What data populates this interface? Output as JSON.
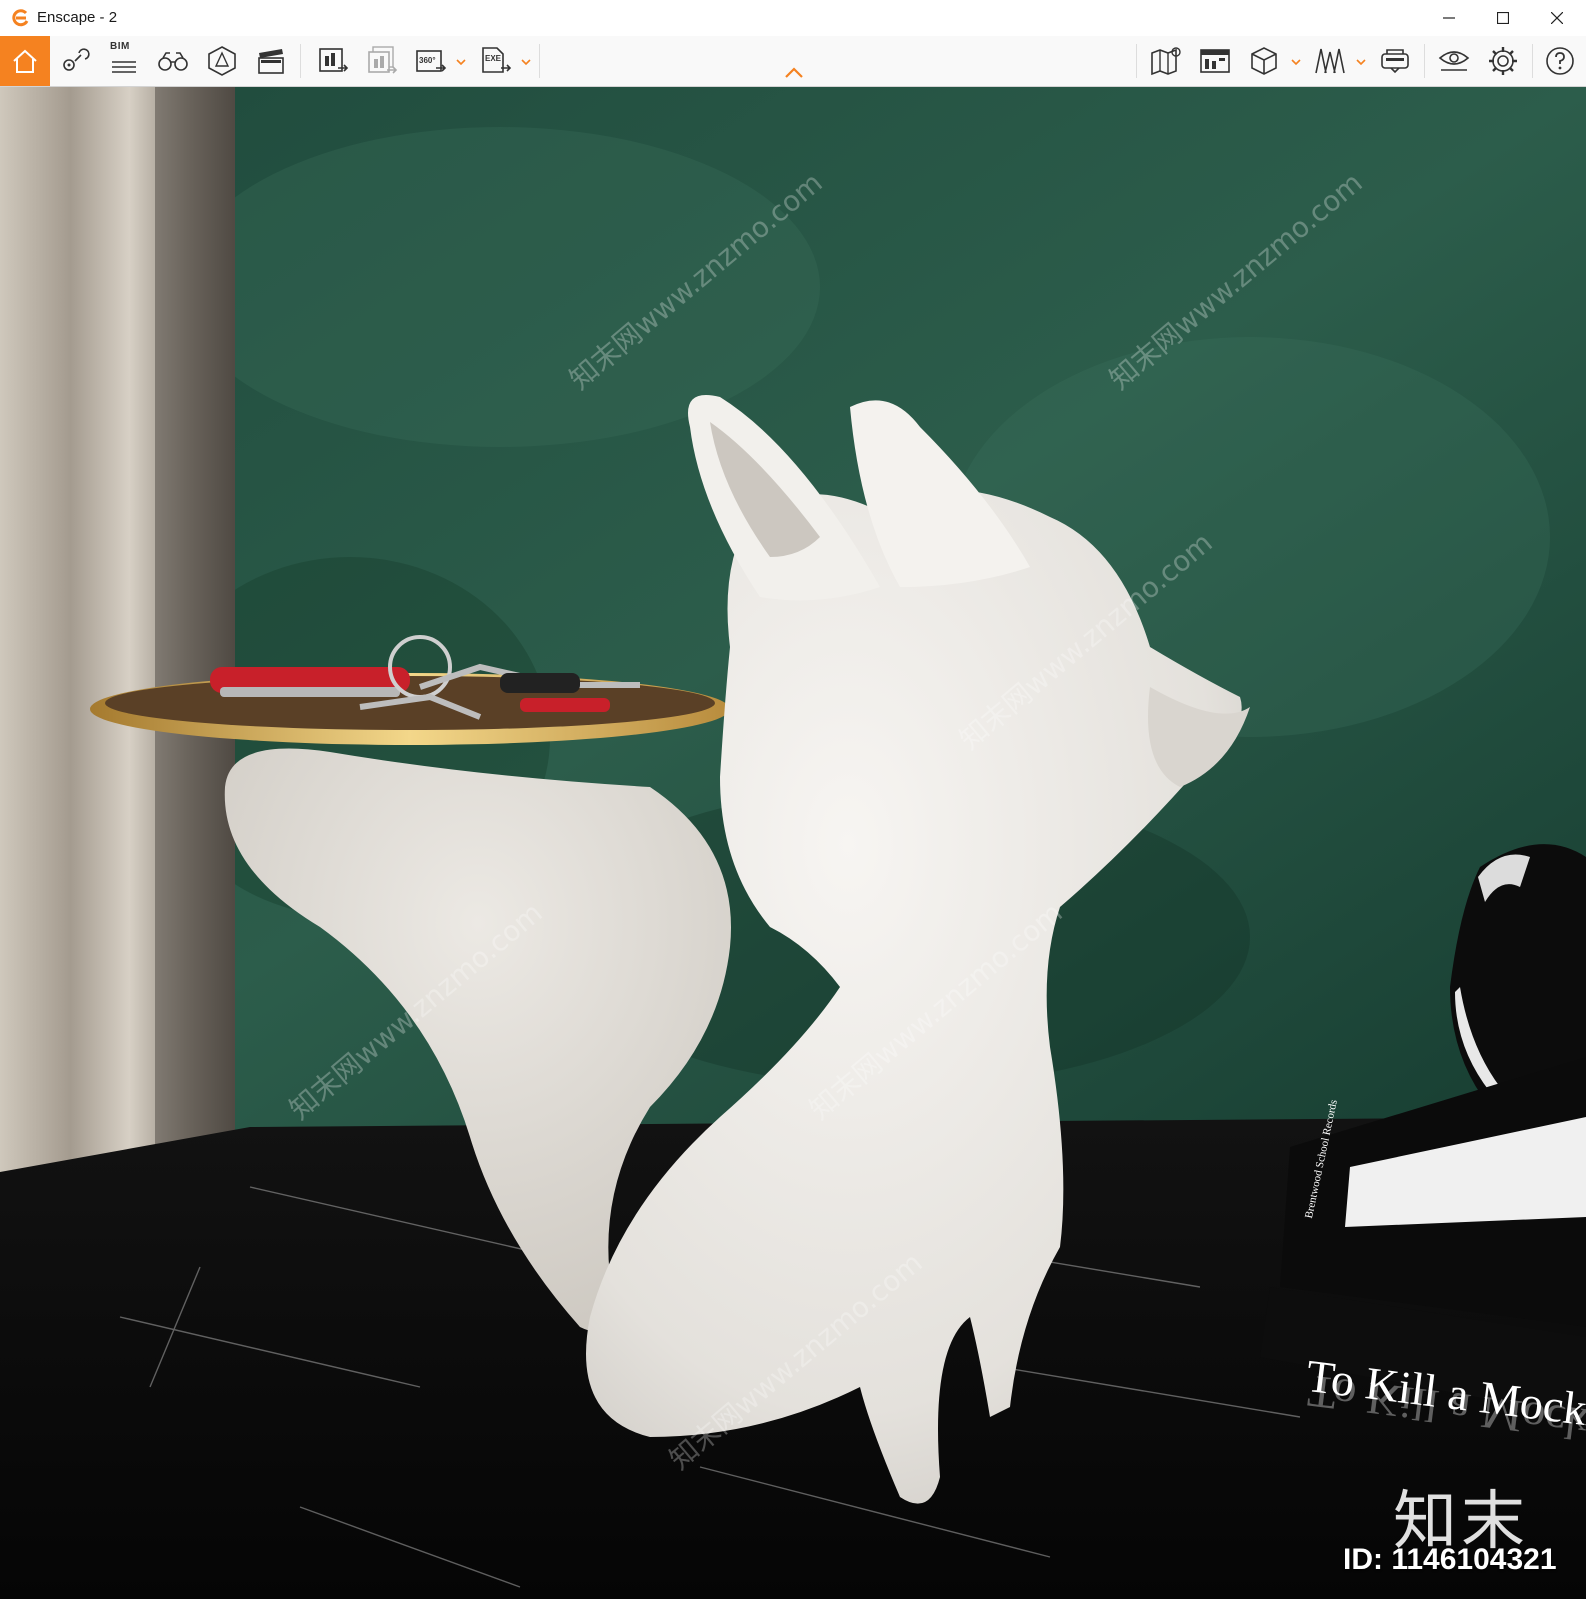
{
  "window": {
    "title": "Enscape - 2",
    "minimize_icon": "minimize-icon",
    "maximize_icon": "maximize-icon",
    "close_icon": "close-icon"
  },
  "toolbar": {
    "accent_color": "#f58220",
    "bim_label": "BIM",
    "panorama_label": "360°",
    "exe_label": "EXE",
    "left_tools": [
      "home-icon",
      "location-pin-icon",
      "bim-icon",
      "binoculars-icon",
      "asset-library-icon",
      "video-editor-icon",
      "screenshot-export-icon",
      "batch-render-icon",
      "panorama-icon",
      "exe-export-icon"
    ],
    "right_tools": [
      "map-icon",
      "information-panel-icon",
      "cube-view-icon",
      "views-icon",
      "vr-headset-icon",
      "visual-settings-icon",
      "settings-gear-icon",
      "help-icon"
    ]
  },
  "viewport": {
    "book_spine": "Brentwood School Records",
    "book_title": "To Kill a Mocking",
    "book_title_reflection": "To Kill a Mocking",
    "brand_mark": "知末",
    "image_id": "ID: 1146104321",
    "watermark": "知末网www.znzmo.com"
  }
}
